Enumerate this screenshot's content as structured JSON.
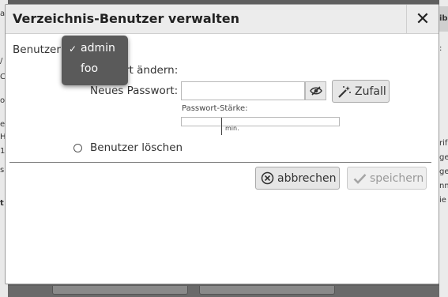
{
  "dialog": {
    "title": "Verzeichnis-Benutzer verwalten",
    "close_glyph": "✕",
    "user_label": "Benutzer",
    "change_password_label": "rt ändern:",
    "new_password_label": "Neues Passwort:",
    "password_value": "",
    "random_button": "Zufall",
    "strength_label": "Passwort-Stärke:",
    "strength_min_label": "min.",
    "delete_user_label": "Benutzer löschen",
    "cancel_button": "abbrechen",
    "save_button": "speichern"
  },
  "user_dropdown": {
    "options": [
      "admin",
      "foo"
    ],
    "selected": "admin",
    "check_glyph": "✓"
  },
  "background": {
    "left_fragments": [
      "a",
      "/",
      "C",
      "o",
      "e",
      "H",
      "1",
      "s",
      "t"
    ],
    "right_fragments": [
      "ibr",
      ":",
      "rif",
      "ge",
      "ge",
      "nm",
      "ie"
    ]
  },
  "icons": {
    "close": "close-icon",
    "eye": "eye-slash-icon",
    "random": "magic-wand-icon",
    "cancel": "circle-x-icon",
    "save": "checkmark-icon"
  },
  "colors": {
    "overlay": "#5f5f5f",
    "titlebar": "#ececec",
    "dropdown_bg": "#5a5a5a",
    "button_bg": "#e6e6e6",
    "disabled_text": "#9a9a9a"
  }
}
